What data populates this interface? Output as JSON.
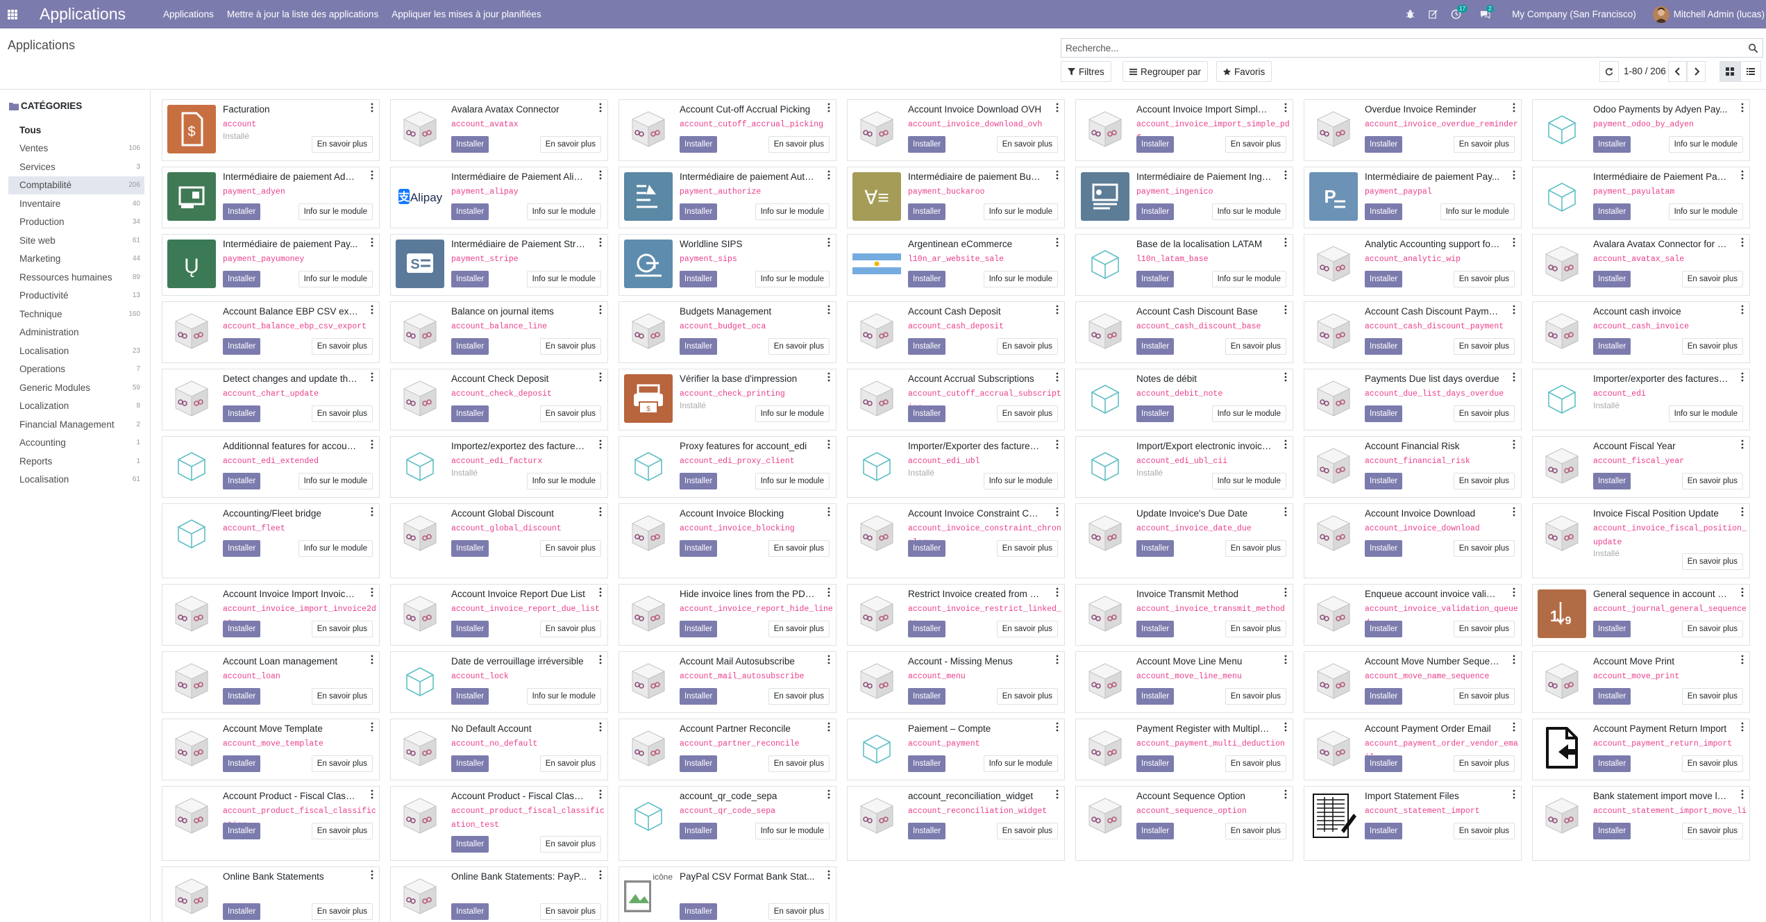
{
  "navbar": {
    "app_name": "Applications",
    "menu": [
      "Applications",
      "Mettre à jour la liste des applications",
      "Appliquer les mises à jour planifiées"
    ],
    "activity_badge": "17",
    "messages_badge": "2",
    "company": "My Company (San Francisco)",
    "user": "Mitchell Admin (lucas)"
  },
  "control_panel": {
    "title": "Applications",
    "search_placeholder": "Recherche...",
    "filters_label": "Filtres",
    "group_label": "Regrouper par",
    "favorites_label": "Favoris",
    "pager": "1-80 / 206"
  },
  "sidebar": {
    "heading": "CATÉGORIES",
    "items": [
      {
        "label": "Tous",
        "count": ""
      },
      {
        "label": "Ventes",
        "count": "106"
      },
      {
        "label": "Services",
        "count": "3"
      },
      {
        "label": "Comptabilité",
        "count": "206"
      },
      {
        "label": "Inventaire",
        "count": "40"
      },
      {
        "label": "Production",
        "count": "34"
      },
      {
        "label": "Site web",
        "count": "61"
      },
      {
        "label": "Marketing",
        "count": "44"
      },
      {
        "label": "Ressources humaines",
        "count": "89"
      },
      {
        "label": "Productivité",
        "count": "13"
      },
      {
        "label": "Technique",
        "count": "160"
      },
      {
        "label": "Administration",
        "count": ""
      },
      {
        "label": "Localisation",
        "count": "23"
      },
      {
        "label": "Operations",
        "count": "7"
      },
      {
        "label": "Generic Modules",
        "count": "59"
      },
      {
        "label": "Localization",
        "count": "8"
      },
      {
        "label": "Financial Management",
        "count": "2"
      },
      {
        "label": "Accounting",
        "count": "1"
      },
      {
        "label": "Reports",
        "count": "1"
      },
      {
        "label": "Localisation",
        "count": "61"
      }
    ]
  },
  "labels": {
    "install": "Installer",
    "installed": "Installé",
    "learn_more": "En savoir plus",
    "module_info": "Info sur le module",
    "icon_alt": "icône"
  },
  "apps": [
    {
      "title": "Facturation",
      "tech": "account",
      "icon": "invoicing-app-icon",
      "installed": true,
      "more": "learn"
    },
    {
      "title": "Avalara Avatax Connector",
      "tech": "account_avatax",
      "icon": "odoo-box-icon",
      "installed": false,
      "more": "learn"
    },
    {
      "title": "Account Cut-off Accrual Picking",
      "tech": "account_cutoff_accrual_picking",
      "icon": "odoo-box-icon",
      "installed": false,
      "more": "learn"
    },
    {
      "title": "Account Invoice Download OVH",
      "tech": "account_invoice_download_ovh",
      "icon": "odoo-box-icon",
      "installed": false,
      "more": "learn"
    },
    {
      "title": "Account Invoice Import Simple ...",
      "tech": "account_invoice_import_simple_pdf",
      "icon": "odoo-box-icon",
      "installed": false,
      "more": "learn"
    },
    {
      "title": "Overdue Invoice Reminder",
      "tech": "account_invoice_overdue_reminder",
      "icon": "odoo-box-icon",
      "installed": false,
      "more": "learn"
    },
    {
      "title": "Odoo Payments by Adyen Pay...",
      "tech": "payment_odoo_by_adyen",
      "icon": "cube-outline-icon",
      "installed": false,
      "more": "info"
    },
    {
      "title": "Intermédiaire de paiement Adyen",
      "tech": "payment_adyen",
      "icon": "adyen-icon",
      "installed": false,
      "more": "info"
    },
    {
      "title": "Intermédiaire de Paiement Alipay",
      "tech": "payment_alipay",
      "icon": "alipay-icon",
      "installed": false,
      "more": "info"
    },
    {
      "title": "Intermédiaire de paiement Auth...",
      "tech": "payment_authorize",
      "icon": "authorize-icon",
      "installed": false,
      "more": "info"
    },
    {
      "title": "Intermédiaire de paiement Buc...",
      "tech": "payment_buckaroo",
      "icon": "buckaroo-icon",
      "installed": false,
      "more": "info"
    },
    {
      "title": "Intermédiaire de Paiement Inge...",
      "tech": "payment_ingenico",
      "icon": "ingenico-icon",
      "installed": false,
      "more": "info"
    },
    {
      "title": "Intermédiaire de paiement Pay...",
      "tech": "payment_paypal",
      "icon": "paypal-icon",
      "installed": false,
      "more": "info"
    },
    {
      "title": "Intermédiaire de Paiement Pay...",
      "tech": "payment_payulatam",
      "icon": "cube-outline-icon",
      "installed": false,
      "more": "info"
    },
    {
      "title": "Intermédiaire de paiement Pay...",
      "tech": "payment_payumoney",
      "icon": "payumoney-icon",
      "installed": false,
      "more": "info"
    },
    {
      "title": "Intermédiaire de Paiement Stripe",
      "tech": "payment_stripe",
      "icon": "stripe-icon",
      "installed": false,
      "more": "info"
    },
    {
      "title": "Worldline SIPS",
      "tech": "payment_sips",
      "icon": "sips-icon",
      "installed": false,
      "more": "info"
    },
    {
      "title": "Argentinean eCommerce",
      "tech": "l10n_ar_website_sale",
      "icon": "argentina-flag-icon",
      "installed": false,
      "more": "info"
    },
    {
      "title": "Base de la localisation LATAM",
      "tech": "l10n_latam_base",
      "icon": "cube-outline-icon",
      "installed": false,
      "more": "info"
    },
    {
      "title": "Analytic Accounting support for ...",
      "tech": "account_analytic_wip",
      "icon": "odoo-box-icon",
      "installed": false,
      "more": "learn"
    },
    {
      "title": "Avalara Avatax Connector for S...",
      "tech": "account_avatax_sale",
      "icon": "odoo-box-icon",
      "installed": false,
      "more": "learn"
    },
    {
      "title": "Account Balance EBP CSV exp...",
      "tech": "account_balance_ebp_csv_export",
      "icon": "odoo-box-icon",
      "installed": false,
      "more": "learn"
    },
    {
      "title": "Balance on journal items",
      "tech": "account_balance_line",
      "icon": "odoo-box-icon",
      "installed": false,
      "more": "learn"
    },
    {
      "title": "Budgets Management",
      "tech": "account_budget_oca",
      "icon": "odoo-box-icon",
      "installed": false,
      "more": "learn"
    },
    {
      "title": "Account Cash Deposit",
      "tech": "account_cash_deposit",
      "icon": "odoo-box-icon",
      "installed": false,
      "more": "learn"
    },
    {
      "title": "Account Cash Discount Base",
      "tech": "account_cash_discount_base",
      "icon": "odoo-box-icon",
      "installed": false,
      "more": "learn"
    },
    {
      "title": "Account Cash Discount Payment",
      "tech": "account_cash_discount_payment",
      "icon": "odoo-box-icon",
      "installed": false,
      "more": "learn"
    },
    {
      "title": "Account cash invoice",
      "tech": "account_cash_invoice",
      "icon": "odoo-box-icon",
      "installed": false,
      "more": "learn"
    },
    {
      "title": "Detect changes and update the...",
      "tech": "account_chart_update",
      "icon": "odoo-box-icon",
      "installed": false,
      "more": "learn"
    },
    {
      "title": "Account Check Deposit",
      "tech": "account_check_deposit",
      "icon": "odoo-box-icon",
      "installed": false,
      "more": "learn"
    },
    {
      "title": "Vérifier la base d'impression",
      "tech": "account_check_printing",
      "icon": "check-printing-icon",
      "installed": true,
      "more": "info"
    },
    {
      "title": "Account Accrual Subscriptions",
      "tech": "account_cutoff_accrual_subscription",
      "icon": "odoo-box-icon",
      "installed": false,
      "more": "learn"
    },
    {
      "title": "Notes de débit",
      "tech": "account_debit_note",
      "icon": "cube-outline-icon",
      "installed": false,
      "more": "info"
    },
    {
      "title": "Payments Due list days overdue",
      "tech": "account_due_list_days_overdue",
      "icon": "odoo-box-icon",
      "installed": false,
      "more": "learn"
    },
    {
      "title": "Importer/exporter des factures ...",
      "tech": "account_edi",
      "icon": "cube-outline-icon",
      "installed": true,
      "more": "info"
    },
    {
      "title": "Additionnal features for account...",
      "tech": "account_edi_extended",
      "icon": "cube-outline-icon",
      "installed": false,
      "more": "info"
    },
    {
      "title": "Importez/exportez des factures ...",
      "tech": "account_edi_facturx",
      "icon": "cube-outline-icon",
      "installed": true,
      "more": "info"
    },
    {
      "title": "Proxy features for account_edi",
      "tech": "account_edi_proxy_client",
      "icon": "cube-outline-icon",
      "installed": false,
      "more": "info"
    },
    {
      "title": "Importer/Exporter des factures ...",
      "tech": "account_edi_ubl",
      "icon": "cube-outline-icon",
      "installed": true,
      "more": "info"
    },
    {
      "title": "Import/Export electronic invoice...",
      "tech": "account_edi_ubl_cii",
      "icon": "cube-outline-icon",
      "installed": true,
      "more": "info"
    },
    {
      "title": "Account Financial Risk",
      "tech": "account_financial_risk",
      "icon": "odoo-box-icon",
      "installed": false,
      "more": "learn"
    },
    {
      "title": "Account Fiscal Year",
      "tech": "account_fiscal_year",
      "icon": "odoo-box-icon",
      "installed": false,
      "more": "learn"
    },
    {
      "title": "Accounting/Fleet bridge",
      "tech": "account_fleet",
      "icon": "cube-outline-icon",
      "installed": false,
      "more": "info"
    },
    {
      "title": "Account Global Discount",
      "tech": "account_global_discount",
      "icon": "odoo-box-icon",
      "installed": false,
      "more": "learn"
    },
    {
      "title": "Account Invoice Blocking",
      "tech": "account_invoice_blocking",
      "icon": "odoo-box-icon",
      "installed": false,
      "more": "learn"
    },
    {
      "title": "Account Invoice Constraint Chr...",
      "tech": "account_invoice_constraint_chronology",
      "icon": "odoo-box-icon",
      "installed": false,
      "more": "learn"
    },
    {
      "title": "Update Invoice's Due Date",
      "tech": "account_invoice_date_due",
      "icon": "odoo-box-icon",
      "installed": false,
      "more": "learn"
    },
    {
      "title": "Account Invoice Download",
      "tech": "account_invoice_download",
      "icon": "odoo-box-icon",
      "installed": false,
      "more": "learn"
    },
    {
      "title": "Invoice Fiscal Position Update",
      "tech": "account_invoice_fiscal_position_update",
      "icon": "odoo-box-icon",
      "installed": true,
      "more": "learn"
    },
    {
      "title": "Account Invoice Import Invoice...",
      "tech": "account_invoice_import_invoice2data",
      "icon": "odoo-box-icon",
      "installed": false,
      "more": "learn"
    },
    {
      "title": "Account Invoice Report Due List",
      "tech": "account_invoice_report_due_list",
      "icon": "odoo-box-icon",
      "installed": false,
      "more": "learn"
    },
    {
      "title": "Hide invoice lines from the PDF...",
      "tech": "account_invoice_report_hide_line",
      "icon": "odoo-box-icon",
      "installed": false,
      "more": "learn"
    },
    {
      "title": "Restrict Invoice created from SO",
      "tech": "account_invoice_restrict_linked_so",
      "icon": "odoo-box-icon",
      "installed": false,
      "more": "learn"
    },
    {
      "title": "Invoice Transmit Method",
      "tech": "account_invoice_transmit_method",
      "icon": "odoo-box-icon",
      "installed": false,
      "more": "learn"
    },
    {
      "title": "Enqueue account invoice valida...",
      "tech": "account_invoice_validation_queued",
      "icon": "odoo-box-icon",
      "installed": false,
      "more": "learn"
    },
    {
      "title": "General sequence in account jo...",
      "tech": "account_journal_general_sequence",
      "icon": "sequence-icon",
      "installed": false,
      "more": "learn"
    },
    {
      "title": "Account Loan management",
      "tech": "account_loan",
      "icon": "odoo-box-icon",
      "installed": false,
      "more": "learn"
    },
    {
      "title": "Date de verrouillage irréversible",
      "tech": "account_lock",
      "icon": "cube-outline-icon",
      "installed": false,
      "more": "info"
    },
    {
      "title": "Account Mail Autosubscribe",
      "tech": "account_mail_autosubscribe",
      "icon": "odoo-box-icon",
      "installed": false,
      "more": "learn"
    },
    {
      "title": "Account - Missing Menus",
      "tech": "account_menu",
      "icon": "odoo-box-icon",
      "installed": false,
      "more": "learn"
    },
    {
      "title": "Account Move Line Menu",
      "tech": "account_move_line_menu",
      "icon": "odoo-box-icon",
      "installed": false,
      "more": "learn"
    },
    {
      "title": "Account Move Number Sequen...",
      "tech": "account_move_name_sequence",
      "icon": "odoo-box-icon",
      "installed": false,
      "more": "learn"
    },
    {
      "title": "Account Move Print",
      "tech": "account_move_print",
      "icon": "odoo-box-icon",
      "installed": false,
      "more": "learn"
    },
    {
      "title": "Account Move Template",
      "tech": "account_move_template",
      "icon": "odoo-box-icon",
      "installed": false,
      "more": "learn"
    },
    {
      "title": "No Default Account",
      "tech": "account_no_default",
      "icon": "odoo-box-icon",
      "installed": false,
      "more": "learn"
    },
    {
      "title": "Account Partner Reconcile",
      "tech": "account_partner_reconcile",
      "icon": "odoo-box-icon",
      "installed": false,
      "more": "learn"
    },
    {
      "title": "Paiement – Compte",
      "tech": "account_payment",
      "icon": "cube-outline-icon",
      "installed": false,
      "more": "info"
    },
    {
      "title": "Payment Register with Multiple ...",
      "tech": "account_payment_multi_deduction",
      "icon": "odoo-box-icon",
      "installed": false,
      "more": "learn"
    },
    {
      "title": "Account Payment Order Email",
      "tech": "account_payment_order_vendor_email",
      "icon": "odoo-box-icon",
      "installed": false,
      "more": "learn"
    },
    {
      "title": "Account Payment Return Import",
      "tech": "account_payment_return_import",
      "icon": "file-import-icon",
      "installed": false,
      "more": "learn"
    },
    {
      "title": "Account Product - Fiscal Classi...",
      "tech": "account_product_fiscal_classification",
      "icon": "odoo-box-icon",
      "installed": false,
      "more": "learn"
    },
    {
      "title": "Account Product - Fiscal Classi...",
      "tech": "account_product_fiscal_classification_test",
      "icon": "odoo-box-icon",
      "installed": false,
      "more": "learn"
    },
    {
      "title": "account_qr_code_sepa",
      "tech": "account_qr_code_sepa",
      "icon": "cube-outline-icon",
      "installed": false,
      "more": "info"
    },
    {
      "title": "account_reconciliation_widget",
      "tech": "account_reconciliation_widget",
      "icon": "odoo-box-icon",
      "installed": false,
      "more": "learn"
    },
    {
      "title": "Account Sequence Option",
      "tech": "account_sequence_option",
      "icon": "odoo-box-icon",
      "installed": false,
      "more": "learn"
    },
    {
      "title": "Import Statement Files",
      "tech": "account_statement_import",
      "icon": "statement-doc-icon",
      "installed": false,
      "more": "learn"
    },
    {
      "title": "Bank statement import move lin...",
      "tech": "account_statement_import_move_line",
      "icon": "odoo-box-icon",
      "installed": false,
      "more": "learn"
    },
    {
      "title": "Online Bank Statements",
      "tech": "",
      "icon": "odoo-box-icon",
      "installed": false,
      "more": "learn"
    },
    {
      "title": "Online Bank Statements: PayP...",
      "tech": "",
      "icon": "odoo-box-icon",
      "installed": false,
      "more": "learn"
    },
    {
      "title": "PayPal CSV Format Bank Stat...",
      "tech": "",
      "icon": "broken-image-icon",
      "installed": false,
      "more": "learn"
    }
  ]
}
